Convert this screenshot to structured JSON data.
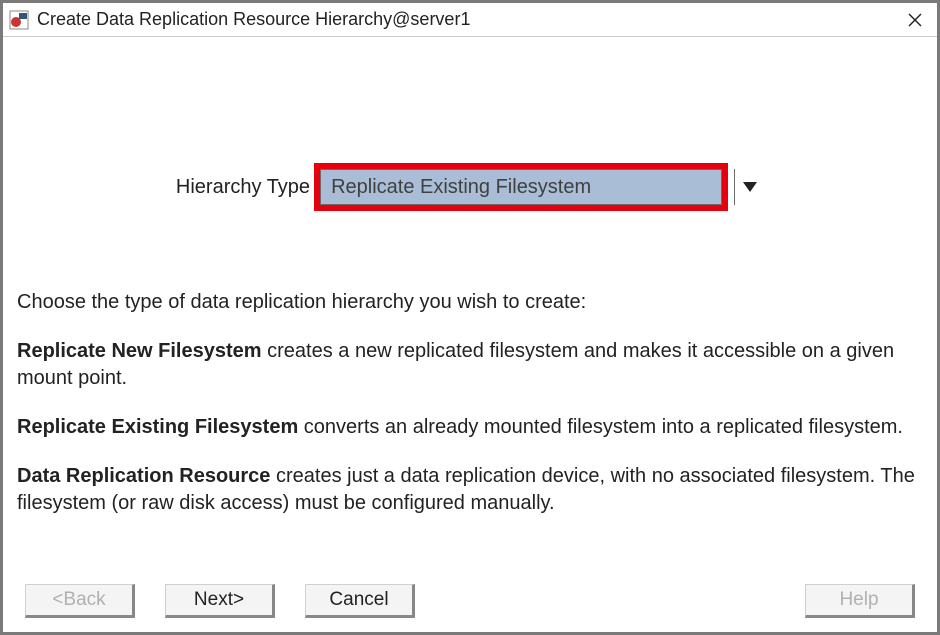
{
  "titlebar": {
    "title": "Create Data Replication Resource Hierarchy@server1"
  },
  "combo": {
    "label": "Hierarchy Type",
    "selected": "Replicate Existing Filesystem"
  },
  "description": {
    "intro": "Choose the type of data replication hierarchy you wish to create:",
    "opt1_title": "Replicate New Filesystem",
    "opt1_text": " creates a new replicated filesystem and makes it accessible on a given mount point.",
    "opt2_title": "Replicate Existing Filesystem",
    "opt2_text": " converts an already mounted filesystem into a replicated filesystem.",
    "opt3_title": "Data Replication Resource",
    "opt3_text": " creates just a data replication device, with no associated filesystem. The filesystem (or raw disk access) must be configured manually."
  },
  "buttons": {
    "back": "<Back",
    "next": "Next>",
    "cancel": "Cancel",
    "help": "Help"
  }
}
